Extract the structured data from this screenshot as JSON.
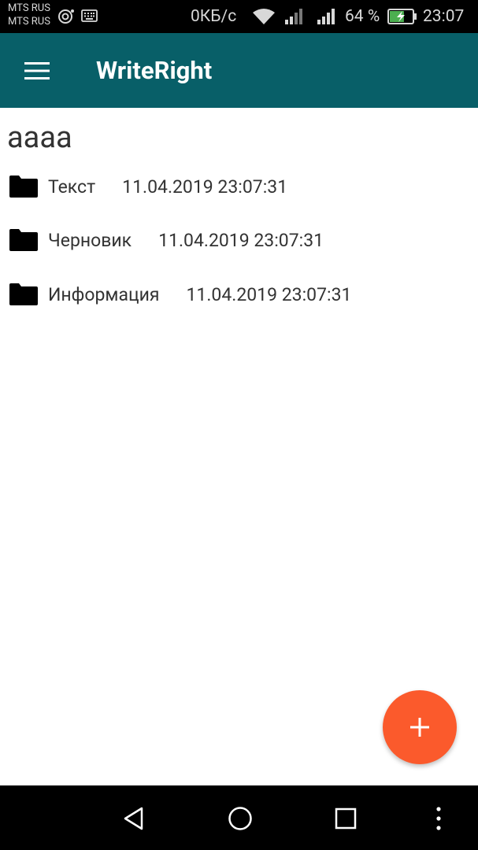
{
  "status_bar": {
    "carrier_1": "MTS RUS",
    "carrier_2": "MTS RUS",
    "net_speed": "0КБ/с",
    "battery_percent": "64 %",
    "time": "23:07",
    "battery_level": 0.64,
    "battery_color": "#4caf50"
  },
  "app_bar": {
    "title": "WriteRight",
    "color": "#085f68"
  },
  "project": {
    "title": "аааа"
  },
  "items": [
    {
      "name": "Текст",
      "date": "11.04.2019 23:07:31"
    },
    {
      "name": "Черновик",
      "date": "11.04.2019 23:07:31"
    },
    {
      "name": "Информация",
      "date": "11.04.2019 23:07:31"
    }
  ],
  "fab": {
    "icon": "plus-icon",
    "color": "#fb5a2c"
  },
  "nav_bar": {
    "back_icon": "triangle-back-icon",
    "home_icon": "circle-home-icon",
    "recents_icon": "square-recents-icon",
    "more_icon": "vertical-dots-icon"
  }
}
